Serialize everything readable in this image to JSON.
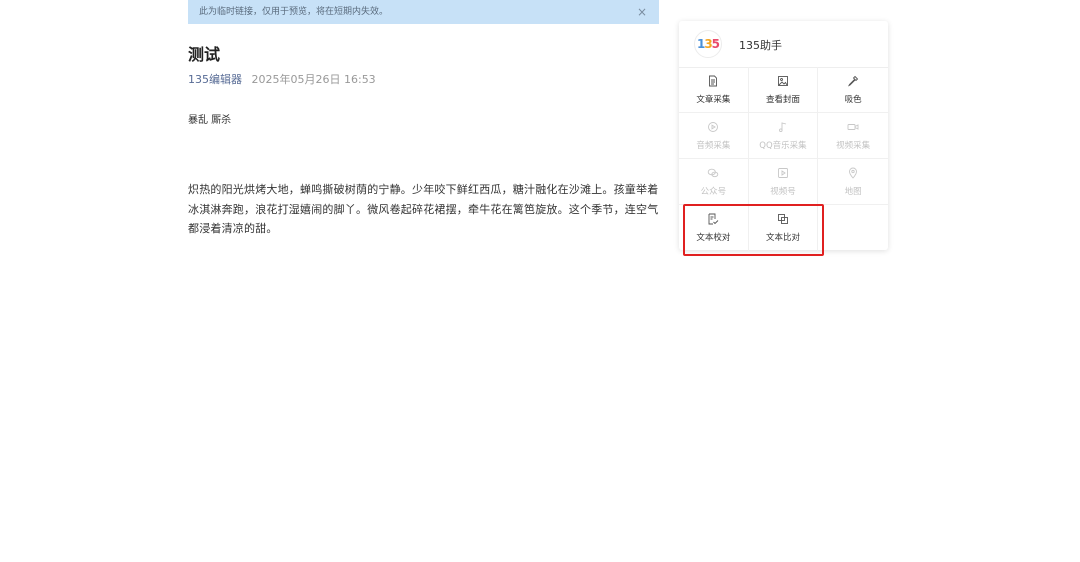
{
  "notice": {
    "text": "此为临时链接，仅用于预览，将在短期内失效。",
    "close": "×"
  },
  "article": {
    "title": "测试",
    "author": "135编辑器",
    "date": "2025年05月26日 16:53",
    "tags": "暴乱 厮杀",
    "body": "炽热的阳光烘烤大地，蝉鸣撕破树荫的宁静。少年咬下鲜红西瓜，糖汁融化在沙滩上。孩童举着冰淇淋奔跑，浪花打湿嬉闹的脚丫。微风卷起碎花裙摆，牵牛花在篱笆旋放。这个季节，连空气都浸着清凉的甜。"
  },
  "panel": {
    "logo_text": [
      "1",
      "3",
      "5"
    ],
    "logo_colors": [
      "#4a90d9",
      "#f5a623",
      "#e94b6b"
    ],
    "name": "135助手",
    "tools": [
      {
        "label": "文章采集",
        "icon": "document-icon",
        "enabled": true
      },
      {
        "label": "查看封面",
        "icon": "image-icon",
        "enabled": true
      },
      {
        "label": "吸色",
        "icon": "eyedropper-icon",
        "enabled": true
      },
      {
        "label": "音频采集",
        "icon": "audio-icon",
        "enabled": false
      },
      {
        "label": "QQ音乐采集",
        "icon": "music-note-icon",
        "enabled": false
      },
      {
        "label": "视频采集",
        "icon": "video-camera-icon",
        "enabled": false
      },
      {
        "label": "公众号",
        "icon": "wechat-icon",
        "enabled": false
      },
      {
        "label": "视频号",
        "icon": "play-box-icon",
        "enabled": false
      },
      {
        "label": "地图",
        "icon": "map-pin-icon",
        "enabled": false
      },
      {
        "label": "文本校对",
        "icon": "proofread-icon",
        "enabled": true
      },
      {
        "label": "文本比对",
        "icon": "compare-icon",
        "enabled": true
      }
    ]
  },
  "annotation": {
    "highlight_color": "#e02020"
  }
}
